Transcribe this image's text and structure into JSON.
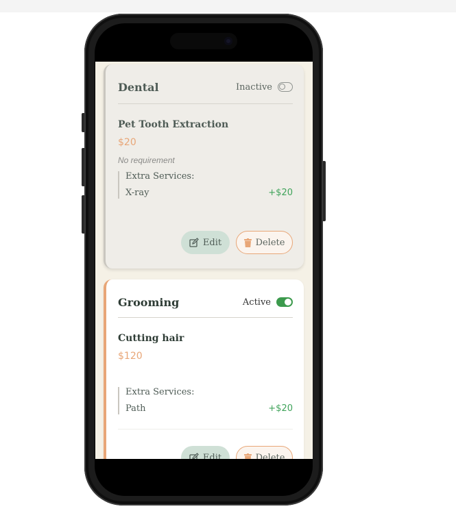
{
  "services": [
    {
      "category": "Dental",
      "status_label": "Inactive",
      "active": false,
      "service_name": "Pet Tooth Extraction",
      "price": "$20",
      "requirement": "No requirement",
      "extras_label": "Extra Services:",
      "extras": [
        {
          "name": "X-ray",
          "price": "+$20"
        }
      ],
      "edit_label": "Edit",
      "delete_label": "Delete"
    },
    {
      "category": "Grooming",
      "status_label": "Active",
      "active": true,
      "service_name": "Cutting hair",
      "price": "$120",
      "requirement": "",
      "extras_label": "Extra Services:",
      "extras": [
        {
          "name": "Path",
          "price": "+$20"
        }
      ],
      "edit_label": "Edit",
      "delete_label": "Delete"
    }
  ],
  "icons": {
    "edit": "edit-icon",
    "delete": "trash-icon",
    "toggle_off": "toggle-off-icon",
    "toggle_on": "toggle-on-icon"
  },
  "colors": {
    "accent": "#e8a677",
    "active_green": "#3c9a4d",
    "extra_price": "#3fa35a",
    "edit_button_bg": "#cfe0d6",
    "background": "#f5f1e6"
  }
}
